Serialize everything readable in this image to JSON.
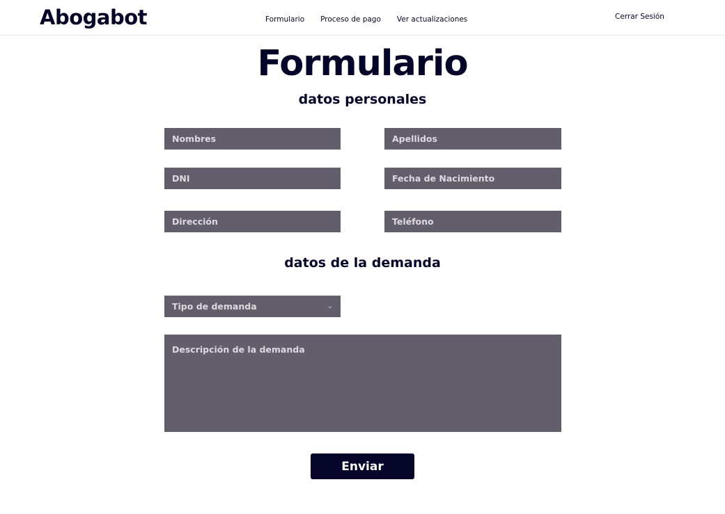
{
  "header": {
    "brand": "Abogabot",
    "nav": [
      {
        "label": "Formulario"
      },
      {
        "label": "Proceso de pago"
      },
      {
        "label": "Ver actualizaciones"
      }
    ],
    "logout_label": "Cerrar Sesión"
  },
  "main": {
    "title": "Formulario",
    "personal_section_title": "datos personales",
    "fields": {
      "nombres": {
        "placeholder": "Nombres",
        "value": ""
      },
      "apellidos": {
        "placeholder": "Apellidos",
        "value": ""
      },
      "dni": {
        "placeholder": "DNI",
        "value": ""
      },
      "fecha_nacimiento": {
        "placeholder": "Fecha de Nacimiento",
        "value": ""
      },
      "direccion": {
        "placeholder": "Dirección",
        "value": ""
      },
      "telefono": {
        "placeholder": "Teléfono",
        "value": ""
      }
    },
    "demand_section_title": "datos de la demanda",
    "tipo_demanda": {
      "selected": "Tipo de demanda",
      "icon": "chevron-down-icon"
    },
    "descripcion": {
      "placeholder": "Descripción de la demanda",
      "value": ""
    },
    "submit_label": "Enviar"
  },
  "colors": {
    "primary": "#05052a",
    "field_bg": "#625e6c",
    "field_text": "#dcdae0",
    "background": "#ffffff"
  }
}
